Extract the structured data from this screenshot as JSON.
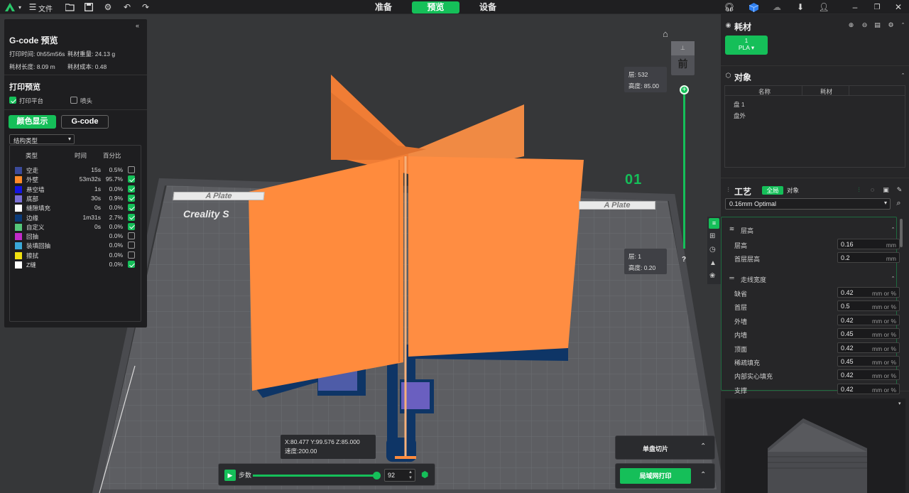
{
  "topbar": {
    "file_label": "文件",
    "tabs": [
      "准备",
      "预览",
      "设备"
    ],
    "active_tab": "预览"
  },
  "left_panel": {
    "title": "G-code 预览",
    "print_time": "打印时间: 0h55m56s",
    "filament_weight": "耗材重量: 24.13 g",
    "filament_length": "耗材长度: 8.09 m",
    "filament_cost": "耗材成本: 0.48",
    "preview_title": "打印预览",
    "opt_plate": "打印平台",
    "opt_nozzle": "喷头",
    "btn_color": "颜色显示",
    "btn_gcode": "G-code",
    "dropdown": "结构类型",
    "col_type": "类型",
    "col_time": "时间",
    "col_pct": "百分比",
    "rows": [
      {
        "name": "空走",
        "time": "15s",
        "pct": "0.5%",
        "color": "#3b4a9a",
        "checked": false
      },
      {
        "name": "外壁",
        "time": "53m32s",
        "pct": "95.7%",
        "color": "#ff8a2a",
        "checked": true
      },
      {
        "name": "悬空墙",
        "time": "1s",
        "pct": "0.0%",
        "color": "#1515e0",
        "checked": true
      },
      {
        "name": "底部",
        "time": "30s",
        "pct": "0.9%",
        "color": "#7a6fd6",
        "checked": true
      },
      {
        "name": "缝隙填充",
        "time": "0s",
        "pct": "0.0%",
        "color": "#ffffff",
        "checked": true
      },
      {
        "name": "边缘",
        "time": "1m31s",
        "pct": "2.7%",
        "color": "#0a3a78",
        "checked": true
      },
      {
        "name": "自定义",
        "time": "0s",
        "pct": "0.0%",
        "color": "#55c77a",
        "checked": true
      },
      {
        "name": "回抽",
        "time": "",
        "pct": "0.0%",
        "color": "#c02bc8",
        "checked": false
      },
      {
        "name": "装填回抽",
        "time": "",
        "pct": "0.0%",
        "color": "#3aa8d8",
        "checked": false
      },
      {
        "name": "擦拭",
        "time": "",
        "pct": "0.0%",
        "color": "#f0e010",
        "checked": false
      },
      {
        "name": "Z缝",
        "time": "",
        "pct": "0.0%",
        "color": "#ffffff",
        "checked": true
      }
    ]
  },
  "viewport": {
    "plate_label_1": "A Plate",
    "plate_label_2": "A Plate",
    "brand_text": "Creality S",
    "plate_number": "01",
    "view_cube": "前",
    "layer_top": "层: 532",
    "height_top": "高度: 85.00",
    "layer_bottom": "层: 1",
    "height_bottom": "高度: 0.20",
    "help": "?",
    "coords": "X:80.477  Y:99.576  Z:85.000",
    "speed": "速度:200.00",
    "steps_label": "步数",
    "steps_value": "92",
    "steps_fraction": 0.98,
    "single_plate_slice": "单盘切片",
    "lan_print": "局域网打印"
  },
  "right_panel": {
    "filament_title": "耗材",
    "filament_slot_num": "1",
    "filament_slot_type": "PLA",
    "objects_title": "对象",
    "col_name": "名称",
    "col_filament": "耗材",
    "plate_item": "盘 1",
    "outside_item": "盘外",
    "process_title": "工艺",
    "process_tab_global": "全局",
    "process_tab_object": "对象",
    "profile": "0.16mm Optimal",
    "group_layer": "层高",
    "group_line": "走线宽度",
    "layer_params": [
      {
        "label": "层高",
        "value": "0.16",
        "unit": "mm"
      },
      {
        "label": "首层层高",
        "value": "0.2",
        "unit": "mm"
      }
    ],
    "line_params": [
      {
        "label": "缺省",
        "value": "0.42",
        "unit": "mm or %"
      },
      {
        "label": "首层",
        "value": "0.5",
        "unit": "mm or %"
      },
      {
        "label": "外墙",
        "value": "0.42",
        "unit": "mm or %"
      },
      {
        "label": "内墙",
        "value": "0.45",
        "unit": "mm or %"
      },
      {
        "label": "顶面",
        "value": "0.42",
        "unit": "mm or %"
      },
      {
        "label": "稀疏填充",
        "value": "0.45",
        "unit": "mm or %"
      },
      {
        "label": "内部实心填充",
        "value": "0.42",
        "unit": "mm or %"
      },
      {
        "label": "支撑",
        "value": "0.42",
        "unit": "mm or %"
      }
    ]
  },
  "colors": {
    "accent": "#15bf59",
    "model": "#ff8a3d",
    "brim": "#0e3566"
  }
}
